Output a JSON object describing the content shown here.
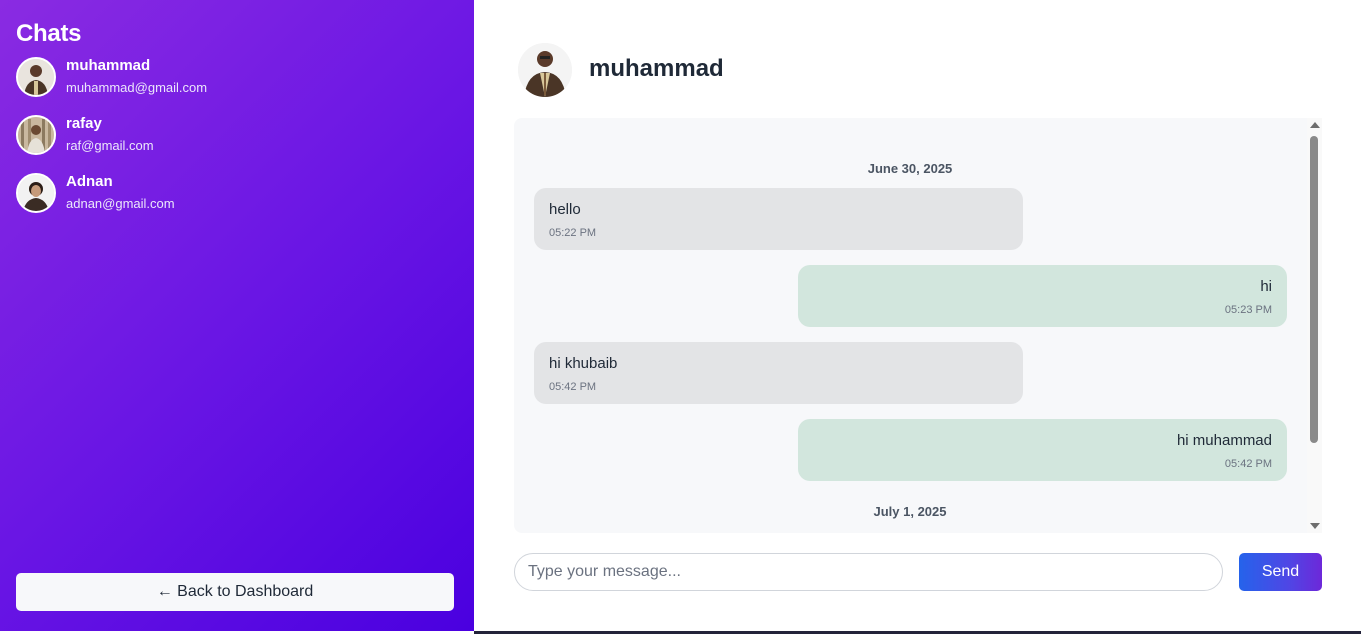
{
  "sidebar": {
    "title": "Chats",
    "contacts": [
      {
        "name": "muhammad",
        "email": "muhammad@gmail.com"
      },
      {
        "name": "rafay",
        "email": "raf@gmail.com"
      },
      {
        "name": "Adnan",
        "email": "adnan@gmail.com"
      }
    ],
    "back_label": "← Back to Dashboard"
  },
  "chat": {
    "contact_name": "muhammad",
    "dates": [
      "June 30, 2025",
      "July 1, 2025"
    ],
    "messages": [
      {
        "text": "hello",
        "time": "05:22 PM",
        "direction": "incoming"
      },
      {
        "text": "hi",
        "time": "05:23 PM",
        "direction": "outgoing"
      },
      {
        "text": "hi khubaib",
        "time": "05:42 PM",
        "direction": "incoming"
      },
      {
        "text": "hi muhammad",
        "time": "05:42 PM",
        "direction": "outgoing"
      }
    ],
    "input_placeholder": "Type your message...",
    "send_label": "Send"
  },
  "colors": {
    "sidebar_gradient_start": "#8a2be2",
    "sidebar_gradient_end": "#4a00e0",
    "incoming_bubble": "#e3e4e6",
    "outgoing_bubble": "#d2e6dd",
    "send_button": "#2563eb"
  }
}
